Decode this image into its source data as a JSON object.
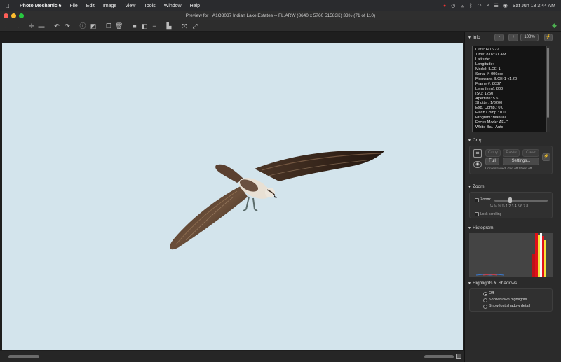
{
  "menubar": {
    "app_name": "Photo Mechanic 6",
    "items": [
      "File",
      "Edit",
      "Image",
      "View",
      "Tools",
      "Window",
      "Help"
    ],
    "clock": "Sat Jun 18  3:44 AM"
  },
  "window": {
    "title": "Preview for _A1O8037 Indian Lake Estates  --  FL.ARW (8640 x 5760 51583K) 33% (71 of 110)"
  },
  "info_panel": {
    "title": "Info",
    "zoom_minus": "-",
    "zoom_plus": "+",
    "zoom_value": "100%",
    "lightning": "⚡",
    "lines": [
      "Date: 6/16/22",
      "Time: 8:07:31 AM",
      "Latitude:",
      "Longitude:",
      "Model: ILCE-1",
      "Serial #: 006ccd",
      "Firmware: ILCE-1 v1.20",
      "Frame #: 8037",
      "Lens (mm): 800",
      "ISO: 1250",
      "Aperture: 5.6",
      "Shutter: 1/3200",
      "Exp. Comp.: 0.0",
      "Flash Comp.: 0.0",
      "Program: Manual",
      "Focus Mode: AF-C",
      "White Bal.: Auto"
    ]
  },
  "crop_panel": {
    "title": "Crop",
    "copy": "Copy",
    "paste": "Paste",
    "clear": "Clear",
    "full": "Full",
    "settings": "Settings...",
    "status": "Unconstrained, Grid off Shield off"
  },
  "zoom_panel": {
    "title": "Zoom",
    "zoom_label": "Zoom:",
    "scale": "¼  ⅓  ½  ¾  1  2  3  4  5  6  7  8",
    "lock_label": "Lock scrolling",
    "zoom_checked": false,
    "lock_checked": false
  },
  "histogram_panel": {
    "title": "Histogram"
  },
  "highlights_panel": {
    "title": "Highlights & Shadows",
    "options": [
      "Off",
      "Show blown highlights",
      "Show lost shadow detail"
    ],
    "selected_index": 0
  },
  "colors": {
    "sky": "#d3e4ec",
    "panel": "#2b2b2b",
    "histogram_red": "#e0101a",
    "histogram_yellow": "#f4e23a",
    "histogram_white": "#f8f8f8"
  }
}
